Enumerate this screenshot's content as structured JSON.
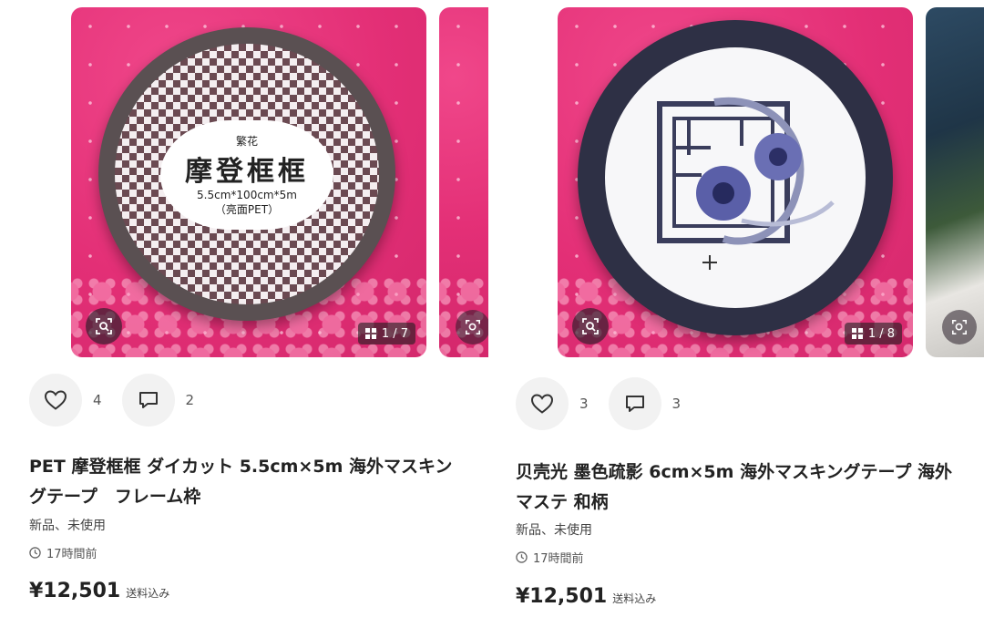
{
  "listings": [
    {
      "image_counter": "1 / 7",
      "like_count": "4",
      "comment_count": "2",
      "title": "PET 摩登框框 ダイカット 5.5cm×5m 海外マスキングテープ　フレーム枠",
      "condition": "新品、未使用",
      "time_ago": "17時間前",
      "price": "¥12,501",
      "shipping": "送料込み",
      "tape_label": {
        "top": "繁花",
        "name": "摩登框框",
        "size": "5.5cm*100cm*5m",
        "material": "（亮面PET）"
      }
    },
    {
      "image_counter": "1 / 8",
      "like_count": "3",
      "comment_count": "3",
      "title": "贝壳光 墨色疏影 6cm×5m 海外マスキングテープ 海外マステ 和柄",
      "condition": "新品、未使用",
      "time_ago": "17時間前",
      "price": "¥12,501",
      "shipping": "送料込み"
    }
  ],
  "colors": {
    "photo_background": "#e32f76",
    "button_background": "#f2f2f2",
    "text_primary": "#222222"
  },
  "icons": [
    "heart-icon",
    "comment-icon",
    "lens-search-icon",
    "grid-icon",
    "clock-icon"
  ]
}
